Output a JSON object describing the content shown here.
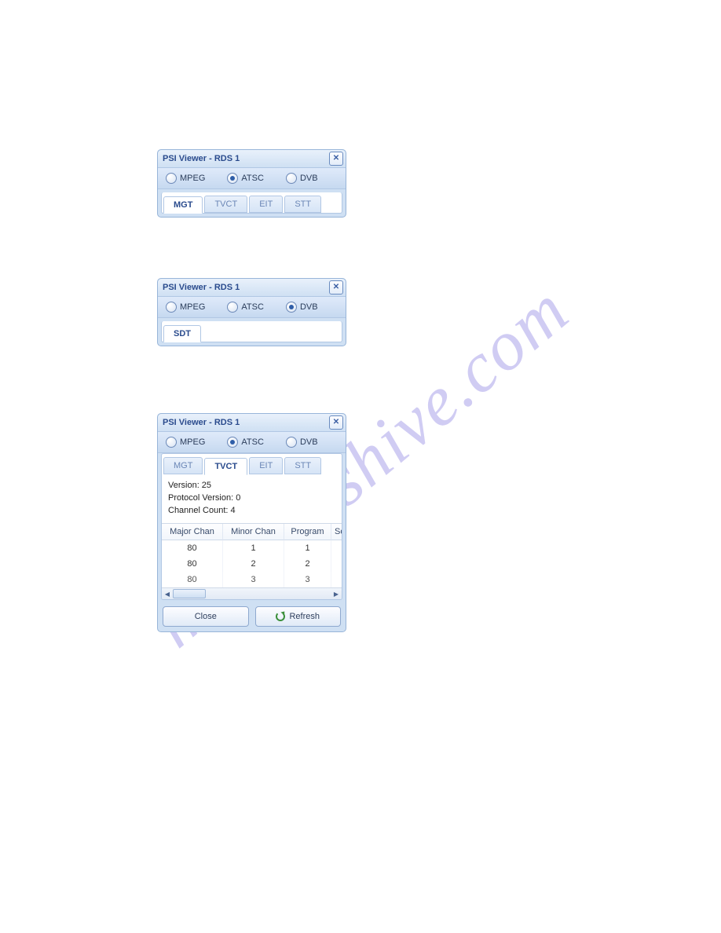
{
  "watermark_text": "manualshive.com",
  "panel1": {
    "title": "PSI Viewer - RDS 1",
    "close_glyph": "✕",
    "radios": [
      {
        "label": "MPEG",
        "selected": false
      },
      {
        "label": "ATSC",
        "selected": true
      },
      {
        "label": "DVB",
        "selected": false
      }
    ],
    "tabs": [
      {
        "label": "MGT",
        "active": true
      },
      {
        "label": "TVCT",
        "active": false
      },
      {
        "label": "EIT",
        "active": false
      },
      {
        "label": "STT",
        "active": false
      }
    ]
  },
  "panel2": {
    "title": "PSI Viewer - RDS 1",
    "close_glyph": "✕",
    "radios": [
      {
        "label": "MPEG",
        "selected": false
      },
      {
        "label": "ATSC",
        "selected": false
      },
      {
        "label": "DVB",
        "selected": true
      }
    ],
    "tabs": [
      {
        "label": "SDT",
        "active": true
      }
    ]
  },
  "panel3": {
    "title": "PSI Viewer - RDS 1",
    "close_glyph": "✕",
    "radios": [
      {
        "label": "MPEG",
        "selected": false
      },
      {
        "label": "ATSC",
        "selected": true
      },
      {
        "label": "DVB",
        "selected": false
      }
    ],
    "tabs": [
      {
        "label": "MGT",
        "active": false
      },
      {
        "label": "TVCT",
        "active": true
      },
      {
        "label": "EIT",
        "active": false
      },
      {
        "label": "STT",
        "active": false
      }
    ],
    "info_lines": {
      "l0": "Version: 25",
      "l1": "Protocol Version: 0",
      "l2": "Channel Count: 4"
    },
    "table": {
      "headers": [
        "Major Chan",
        "Minor Chan",
        "Program",
        "Sou"
      ],
      "rows": [
        [
          "80",
          "1",
          "1"
        ],
        [
          "80",
          "2",
          "2"
        ],
        [
          "80",
          "3",
          "3"
        ]
      ]
    },
    "buttons": {
      "close": "Close",
      "refresh": "Refresh"
    }
  }
}
